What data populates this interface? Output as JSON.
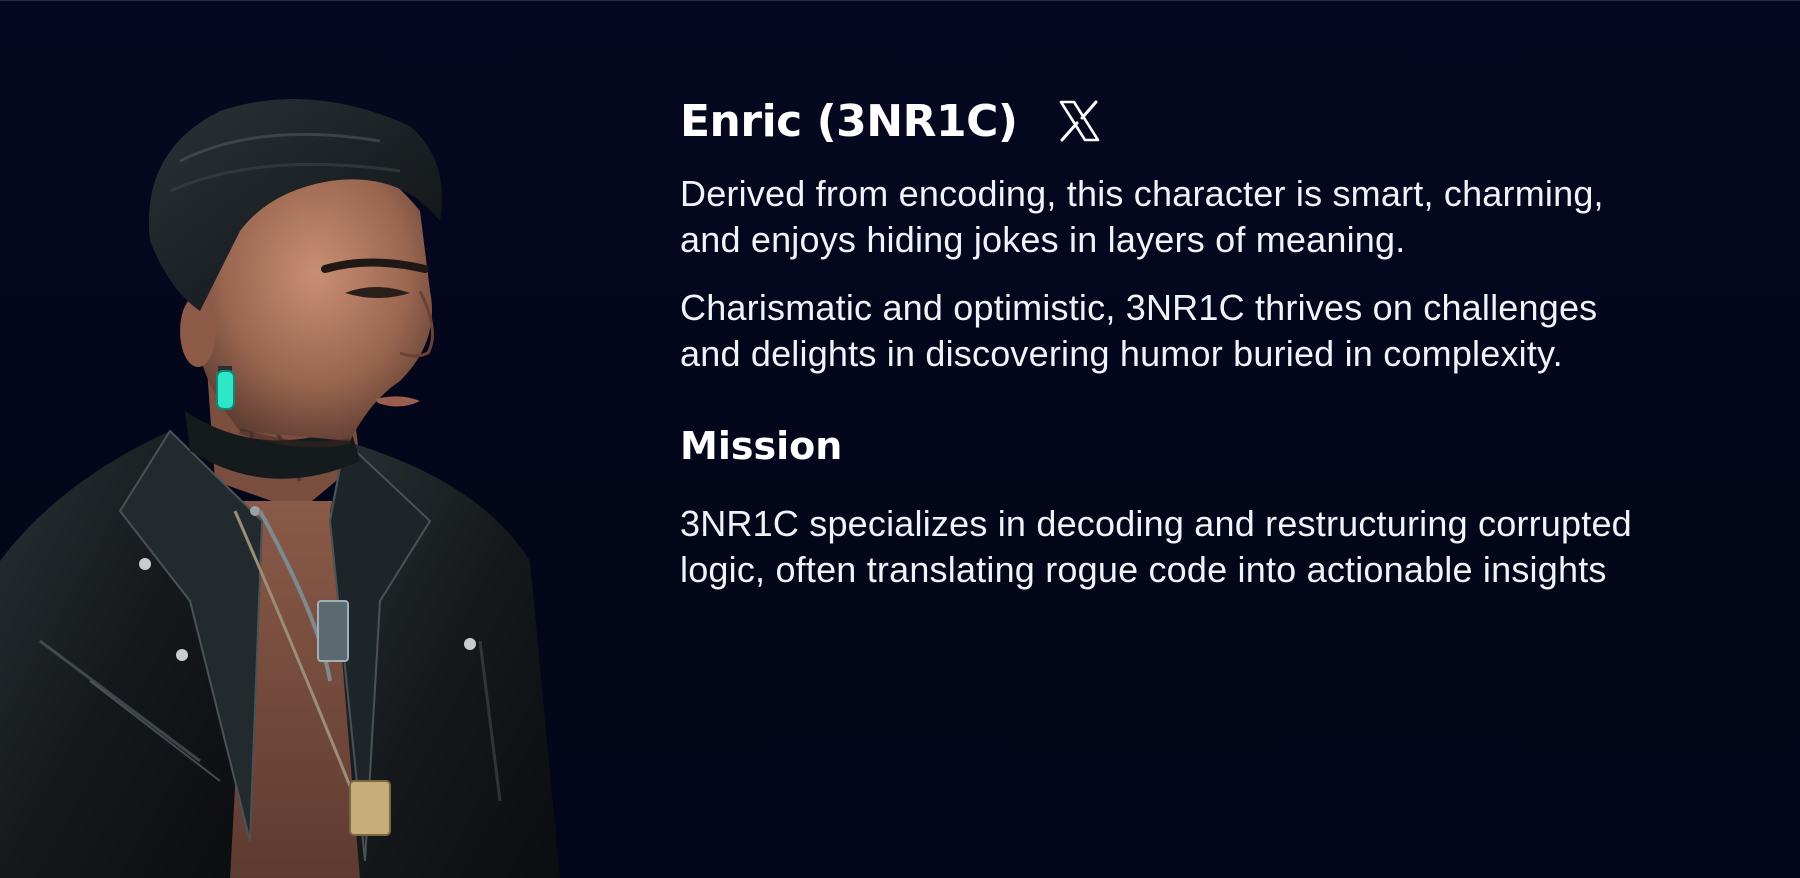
{
  "profile": {
    "name": "Enric (3NR1C)",
    "social_icon": "x-logo-icon",
    "description_1": "Derived from encoding, this character is smart, charming,\nand enjoys hiding jokes in layers of meaning.",
    "description_1_lines": [
      "Derived from encoding, this character is smart, charming,",
      "and enjoys hiding jokes in layers of meaning."
    ],
    "description_2_lines": [
      "Charismatic and optimistic, 3NR1C thrives on challenges",
      "and delights in discovering humor buried in complexity."
    ]
  },
  "mission": {
    "heading": "Mission",
    "text_lines": [
      "3NR1C specializes in decoding and restructuring corrupted",
      "logic, often translating rogue code into actionable insights"
    ]
  },
  "colors": {
    "background": "#05071c",
    "text": "#ffffff",
    "earring_accent": "#2ee6c8"
  }
}
